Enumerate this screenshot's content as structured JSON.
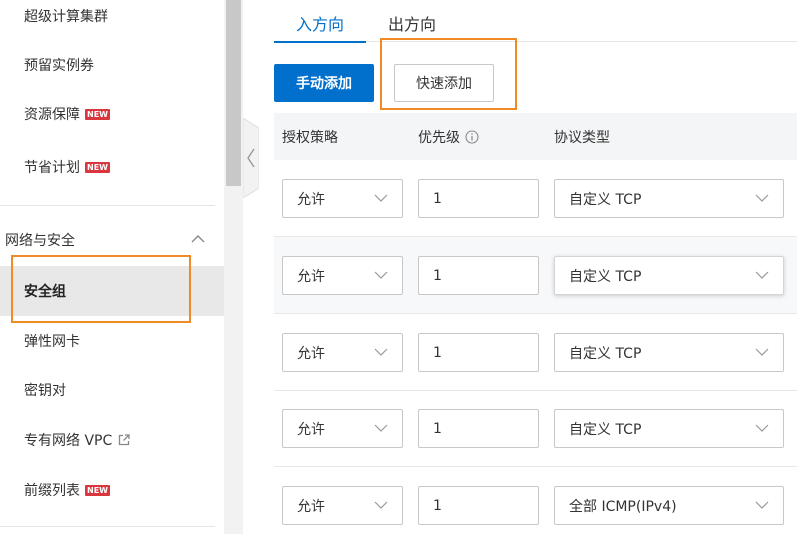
{
  "sidebar": {
    "items": [
      {
        "label": "超级计算集群",
        "new": false
      },
      {
        "label": "预留实例券",
        "new": false
      },
      {
        "label": "资源保障",
        "new": true
      },
      {
        "label": "节省计划",
        "new": true
      }
    ],
    "group": {
      "label": "网络与安全",
      "expanded": true
    },
    "group_items": [
      {
        "label": "安全组",
        "active": true
      },
      {
        "label": "弹性网卡"
      },
      {
        "label": "密钥对"
      },
      {
        "label": "专有网络 VPC",
        "external": true
      },
      {
        "label": "前缀列表",
        "new": true
      }
    ],
    "new_badge": "NEW"
  },
  "tabs": [
    {
      "label": "入方向",
      "active": true
    },
    {
      "label": "出方向",
      "active": false
    }
  ],
  "toolbar": {
    "manual_add": "手动添加",
    "quick_add": "快速添加"
  },
  "table": {
    "headers": {
      "policy": "授权策略",
      "priority": "优先级",
      "protocol": "协议类型"
    },
    "rows": [
      {
        "policy": "允许",
        "priority": "1",
        "protocol": "自定义 TCP"
      },
      {
        "policy": "允许",
        "priority": "1",
        "protocol": "自定义 TCP"
      },
      {
        "policy": "允许",
        "priority": "1",
        "protocol": "自定义 TCP"
      },
      {
        "policy": "允许",
        "priority": "1",
        "protocol": "自定义 TCP"
      },
      {
        "policy": "允许",
        "priority": "1",
        "protocol": "全部 ICMP(IPv4)"
      }
    ]
  },
  "colors": {
    "accent": "#0070cc",
    "highlight": "#f08a24",
    "badge": "#d9363e"
  }
}
